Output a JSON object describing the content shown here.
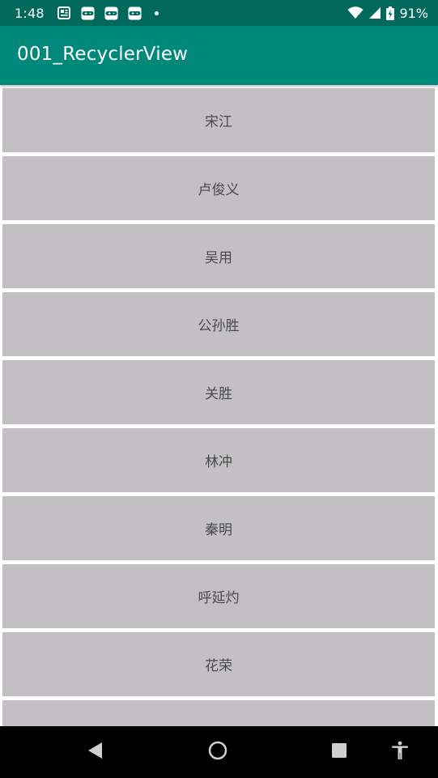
{
  "status_bar": {
    "time": "1:48",
    "notification_icons": [
      "news-icon",
      "gamepad-icon",
      "gamepad-icon",
      "gamepad-icon"
    ],
    "battery_percent": "91%",
    "icons": [
      "wifi-icon",
      "signal-icon",
      "battery-charging-icon"
    ]
  },
  "app_bar": {
    "title": "001_RecyclerView",
    "color": "#00897b",
    "status_color": "#00695c"
  },
  "list": {
    "item_color": "#c3c0c4",
    "items": [
      {
        "label": "宋江"
      },
      {
        "label": "卢俊义"
      },
      {
        "label": "吴用"
      },
      {
        "label": "公孙胜"
      },
      {
        "label": "关胜"
      },
      {
        "label": "林冲"
      },
      {
        "label": "秦明"
      },
      {
        "label": "呼延灼"
      },
      {
        "label": "花荣"
      },
      {
        "label": ""
      }
    ]
  },
  "nav_bar": {
    "buttons": [
      "back-icon",
      "home-icon",
      "recents-icon",
      "accessibility-icon"
    ]
  }
}
